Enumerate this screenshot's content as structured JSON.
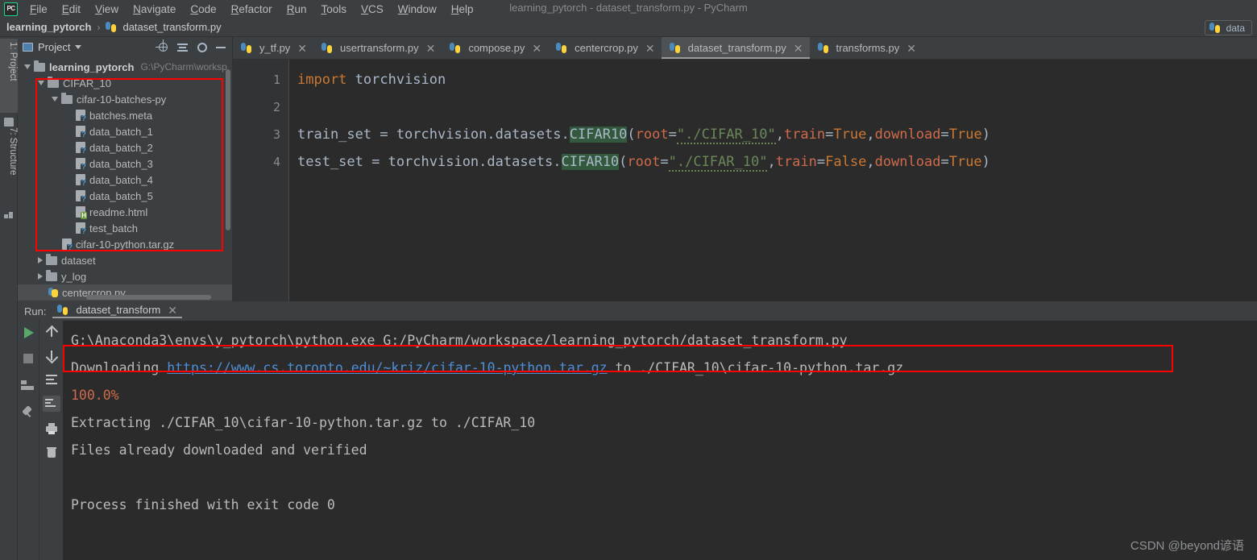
{
  "window": {
    "title": "learning_pytorch - dataset_transform.py - PyCharm",
    "logo": "pycharm-logo"
  },
  "menu": {
    "items": [
      "File",
      "Edit",
      "View",
      "Navigate",
      "Code",
      "Refactor",
      "Run",
      "Tools",
      "VCS",
      "Window",
      "Help"
    ]
  },
  "breadcrumb": {
    "root": "learning_pytorch",
    "separator": "›",
    "file": "dataset_transform.py"
  },
  "run_config": {
    "label": "data"
  },
  "left_strip": {
    "tabs": [
      {
        "label": "1: Project",
        "icon": "folder-icon",
        "active": true
      },
      {
        "label": "7: Structure",
        "icon": "structure-icon",
        "active": false
      }
    ]
  },
  "project_panel": {
    "title": "Project",
    "toolbar": [
      {
        "name": "locate-icon",
        "label": "Select Opened File"
      },
      {
        "name": "collapse-all-icon",
        "label": "Collapse All"
      },
      {
        "name": "gear-icon",
        "label": "Settings"
      },
      {
        "name": "minimize-icon",
        "label": "Hide"
      }
    ],
    "tree": [
      {
        "label": "learning_pytorch",
        "path": "G:\\PyCharm\\worksp",
        "type": "root",
        "arrow": "down",
        "depth": 0
      },
      {
        "label": "CIFAR_10",
        "type": "folder",
        "arrow": "down",
        "depth": 1
      },
      {
        "label": "cifar-10-batches-py",
        "type": "folder",
        "arrow": "down",
        "depth": 2
      },
      {
        "label": "batches.meta",
        "type": "file-unknown",
        "arrow": "none",
        "depth": 3
      },
      {
        "label": "data_batch_1",
        "type": "file-unknown",
        "arrow": "none",
        "depth": 3
      },
      {
        "label": "data_batch_2",
        "type": "file-unknown",
        "arrow": "none",
        "depth": 3
      },
      {
        "label": "data_batch_3",
        "type": "file-unknown",
        "arrow": "none",
        "depth": 3
      },
      {
        "label": "data_batch_4",
        "type": "file-unknown",
        "arrow": "none",
        "depth": 3
      },
      {
        "label": "data_batch_5",
        "type": "file-unknown",
        "arrow": "none",
        "depth": 3
      },
      {
        "label": "readme.html",
        "type": "file-html",
        "arrow": "none",
        "depth": 3
      },
      {
        "label": "test_batch",
        "type": "file-unknown",
        "arrow": "none",
        "depth": 3
      },
      {
        "label": "cifar-10-python.tar.gz",
        "type": "file-unknown",
        "arrow": "none",
        "depth": 2
      },
      {
        "label": "dataset",
        "type": "folder",
        "arrow": "right",
        "depth": 1
      },
      {
        "label": "y_log",
        "type": "folder",
        "arrow": "right",
        "depth": 1
      },
      {
        "label": "centercrop.py",
        "type": "file-py",
        "arrow": "none",
        "depth": 1
      }
    ]
  },
  "editor": {
    "tabs": [
      {
        "label": "y_tf.py",
        "active": false
      },
      {
        "label": "usertransform.py",
        "active": false
      },
      {
        "label": "compose.py",
        "active": false
      },
      {
        "label": "centercrop.py",
        "active": false
      },
      {
        "label": "dataset_transform.py",
        "active": true
      },
      {
        "label": "transforms.py",
        "active": false
      }
    ],
    "line_numbers": [
      "1",
      "2",
      "3",
      "4"
    ],
    "lines": [
      {
        "number": "1",
        "tokens": [
          {
            "t": "import",
            "c": "kw"
          },
          {
            "t": " torchvision",
            "c": "plain"
          }
        ]
      },
      {
        "number": "2",
        "tokens": []
      },
      {
        "number": "3",
        "tokens": [
          {
            "t": "train_set = torchvision.datasets.",
            "c": "plain"
          },
          {
            "t": "CIFAR10",
            "c": "cls"
          },
          {
            "t": "(",
            "c": "plain"
          },
          {
            "t": "root",
            "c": "param"
          },
          {
            "t": "=",
            "c": "plain"
          },
          {
            "t": "\"./CIFAR_10\"",
            "c": "strpath"
          },
          {
            "t": ",",
            "c": "comma"
          },
          {
            "t": "train",
            "c": "param"
          },
          {
            "t": "=",
            "c": "plain"
          },
          {
            "t": "True",
            "c": "kw"
          },
          {
            "t": ",",
            "c": "comma"
          },
          {
            "t": "download",
            "c": "param"
          },
          {
            "t": "=",
            "c": "plain"
          },
          {
            "t": "True",
            "c": "kw"
          },
          {
            "t": ")",
            "c": "plain"
          }
        ]
      },
      {
        "number": "4",
        "tokens": [
          {
            "t": "test_set = torchvision.datasets.",
            "c": "plain"
          },
          {
            "t": "CIFAR10",
            "c": "cls"
          },
          {
            "t": "(",
            "c": "plain"
          },
          {
            "t": "root",
            "c": "param"
          },
          {
            "t": "=",
            "c": "plain"
          },
          {
            "t": "\"./CIFAR_10\"",
            "c": "strpath"
          },
          {
            "t": ",",
            "c": "comma"
          },
          {
            "t": "train",
            "c": "param"
          },
          {
            "t": "=",
            "c": "plain"
          },
          {
            "t": "False",
            "c": "kw"
          },
          {
            "t": ",",
            "c": "comma"
          },
          {
            "t": "download",
            "c": "param"
          },
          {
            "t": "=",
            "c": "plain"
          },
          {
            "t": "True",
            "c": "kw"
          },
          {
            "t": ")",
            "c": "plain"
          }
        ]
      }
    ]
  },
  "run_panel": {
    "label": "Run:",
    "tab_label": "dataset_transform",
    "toolbar_left": [
      {
        "name": "rerun-icon"
      },
      {
        "name": "stop-icon"
      },
      {
        "name": "layout-icon"
      },
      {
        "name": "pin-icon"
      }
    ],
    "toolbar_right": [
      {
        "name": "up-arrow-icon"
      },
      {
        "name": "down-arrow-icon"
      },
      {
        "name": "soft-wrap-icon"
      },
      {
        "name": "scroll-to-end-icon"
      },
      {
        "name": "print-icon"
      },
      {
        "name": "trash-icon"
      }
    ],
    "console": [
      {
        "parts": [
          {
            "t": "G:\\Anaconda3\\envs\\y_pytorch\\python.exe G:/PyCharm/workspace/learning_pytorch/dataset_transform.py",
            "c": "c-white"
          }
        ]
      },
      {
        "parts": [
          {
            "t": "Downloading ",
            "c": "c-white"
          },
          {
            "t": "https://www.cs.toronto.edu/~kriz/cifar-10-python.tar.gz",
            "c": "c-link"
          },
          {
            "t": " to ./CIFAR_10\\cifar-10-python.tar.gz",
            "c": "c-white"
          }
        ]
      },
      {
        "parts": [
          {
            "t": "100.0%",
            "c": "c-red"
          }
        ]
      },
      {
        "parts": [
          {
            "t": "Extracting ./CIFAR_10\\cifar-10-python.tar.gz to ./CIFAR_10",
            "c": "c-white"
          }
        ]
      },
      {
        "parts": [
          {
            "t": "Files already downloaded and verified",
            "c": "c-white"
          }
        ]
      },
      {
        "parts": []
      },
      {
        "parts": [
          {
            "t": "Process finished with exit code 0",
            "c": "c-white"
          }
        ]
      }
    ]
  },
  "watermark": {
    "text": "CSDN @beyond谚语"
  },
  "colors": {
    "accent_red_annotation": "#ff0000",
    "panel_bg": "#3c3f41",
    "editor_bg": "#2b2b2b",
    "keyword": "#cc7832",
    "string": "#6a8759",
    "param": "#cf6a4c",
    "link": "#4e8fd8",
    "play_green": "#59a869"
  }
}
